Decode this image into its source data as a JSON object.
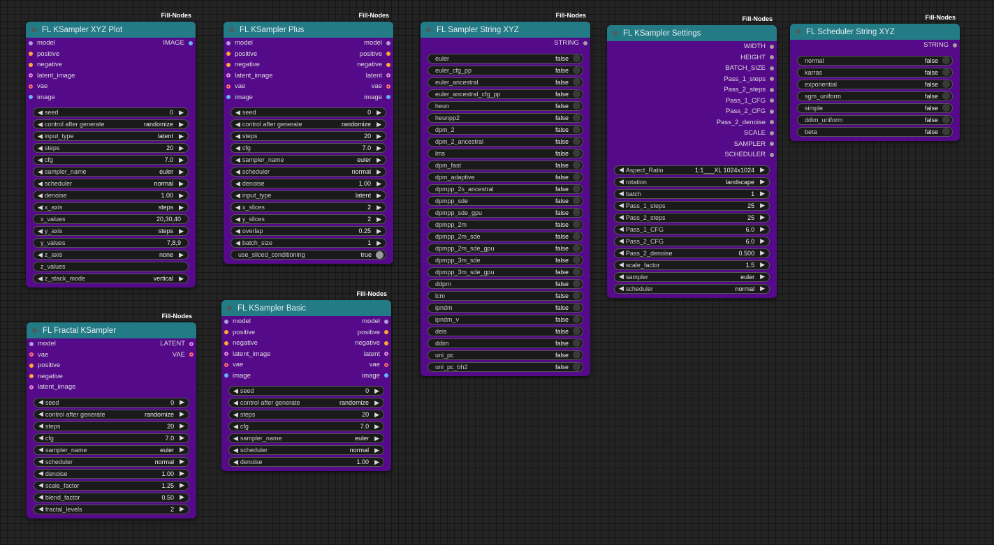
{
  "colors": {
    "header": "#237b86",
    "body": "#550a8a",
    "model_port": "#b39ddb",
    "cond_port": "#ffa931",
    "latent_port": "#ff9cf9",
    "vae_port": "#ff6e6e",
    "image_port": "#64b5f6",
    "string_port": "#a0a0a0"
  },
  "badge": "Fill-Nodes",
  "nodes": {
    "xyz_plot": {
      "title": "FL KSampler XYZ Plot",
      "inputs": [
        "model",
        "positive",
        "negative",
        "latent_image",
        "vae",
        "image"
      ],
      "outputs": [
        "IMAGE"
      ],
      "widgets": [
        {
          "label": "seed",
          "value": "0"
        },
        {
          "label": "control after generate",
          "value": "randomize"
        },
        {
          "label": "input_type",
          "value": "latent"
        },
        {
          "label": "steps",
          "value": "20"
        },
        {
          "label": "cfg",
          "value": "7.0"
        },
        {
          "label": "sampler_name",
          "value": "euler"
        },
        {
          "label": "scheduler",
          "value": "normal"
        },
        {
          "label": "denoise",
          "value": "1.00"
        },
        {
          "label": "x_axis",
          "value": "steps"
        },
        {
          "label": "x_values",
          "value": "20,30,40"
        },
        {
          "label": "y_axis",
          "value": "steps"
        },
        {
          "label": "y_values",
          "value": "7,8,9"
        },
        {
          "label": "z_axis",
          "value": "none"
        },
        {
          "label": "z_values",
          "value": ""
        },
        {
          "label": "z_stack_mode",
          "value": "vertical"
        }
      ]
    },
    "fractal": {
      "title": "FL Fractal KSampler",
      "inputs": [
        "model",
        "vae",
        "positive",
        "negative",
        "latent_image"
      ],
      "outputs": [
        "LATENT",
        "VAE"
      ],
      "widgets": [
        {
          "label": "seed",
          "value": "0"
        },
        {
          "label": "control after generate",
          "value": "randomize"
        },
        {
          "label": "steps",
          "value": "20"
        },
        {
          "label": "cfg",
          "value": "7.0"
        },
        {
          "label": "sampler_name",
          "value": "euler"
        },
        {
          "label": "scheduler",
          "value": "normal"
        },
        {
          "label": "denoise",
          "value": "1.00"
        },
        {
          "label": "scale_factor",
          "value": "1.25"
        },
        {
          "label": "blend_factor",
          "value": "0.50"
        },
        {
          "label": "fractal_levels",
          "value": "2"
        }
      ]
    },
    "plus": {
      "title": "FL KSampler Plus",
      "inputs": [
        "model",
        "positive",
        "negative",
        "latent_image",
        "vae",
        "image"
      ],
      "outputs": [
        "model",
        "positive",
        "negative",
        "latent",
        "vae",
        "image"
      ],
      "widgets": [
        {
          "label": "seed",
          "value": "0"
        },
        {
          "label": "control after generate",
          "value": "randomize"
        },
        {
          "label": "steps",
          "value": "20"
        },
        {
          "label": "cfg",
          "value": "7.0"
        },
        {
          "label": "sampler_name",
          "value": "euler"
        },
        {
          "label": "scheduler",
          "value": "normal"
        },
        {
          "label": "denoise",
          "value": "1.00"
        },
        {
          "label": "input_type",
          "value": "latent"
        },
        {
          "label": "x_slices",
          "value": "2"
        },
        {
          "label": "y_slices",
          "value": "2"
        },
        {
          "label": "overlap",
          "value": "0.25"
        },
        {
          "label": "batch_size",
          "value": "1"
        }
      ],
      "toggle": {
        "label": "use_sliced_conditioning",
        "value": "true"
      }
    },
    "basic": {
      "title": "FL KSampler Basic",
      "inputs": [
        "model",
        "positive",
        "negative",
        "latent_image",
        "vae",
        "image"
      ],
      "outputs": [
        "model",
        "positive",
        "negative",
        "latent",
        "vae",
        "image"
      ],
      "widgets": [
        {
          "label": "seed",
          "value": "0"
        },
        {
          "label": "control after generate",
          "value": "randomize"
        },
        {
          "label": "steps",
          "value": "20"
        },
        {
          "label": "cfg",
          "value": "7.0"
        },
        {
          "label": "sampler_name",
          "value": "euler"
        },
        {
          "label": "scheduler",
          "value": "normal"
        },
        {
          "label": "denoise",
          "value": "1.00"
        }
      ]
    },
    "sampler_string": {
      "title": "FL Sampler String XYZ",
      "outputs": [
        "STRING"
      ],
      "toggles": [
        {
          "label": "euler",
          "value": "false"
        },
        {
          "label": "euler_cfg_pp",
          "value": "false"
        },
        {
          "label": "euler_ancestral",
          "value": "false"
        },
        {
          "label": "euler_ancestral_cfg_pp",
          "value": "false"
        },
        {
          "label": "heun",
          "value": "false"
        },
        {
          "label": "heunpp2",
          "value": "false"
        },
        {
          "label": "dpm_2",
          "value": "false"
        },
        {
          "label": "dpm_2_ancestral",
          "value": "false"
        },
        {
          "label": "lms",
          "value": "false"
        },
        {
          "label": "dpm_fast",
          "value": "false"
        },
        {
          "label": "dpm_adaptive",
          "value": "false"
        },
        {
          "label": "dpmpp_2s_ancestral",
          "value": "false"
        },
        {
          "label": "dpmpp_sde",
          "value": "false"
        },
        {
          "label": "dpmpp_sde_gpu",
          "value": "false"
        },
        {
          "label": "dpmpp_2m",
          "value": "false"
        },
        {
          "label": "dpmpp_2m_sde",
          "value": "false"
        },
        {
          "label": "dpmpp_2m_sde_gpu",
          "value": "false"
        },
        {
          "label": "dpmpp_3m_sde",
          "value": "false"
        },
        {
          "label": "dpmpp_3m_sde_gpu",
          "value": "false"
        },
        {
          "label": "ddpm",
          "value": "false"
        },
        {
          "label": "lcm",
          "value": "false"
        },
        {
          "label": "ipndm",
          "value": "false"
        },
        {
          "label": "ipndm_v",
          "value": "false"
        },
        {
          "label": "deis",
          "value": "false"
        },
        {
          "label": "ddim",
          "value": "false"
        },
        {
          "label": "uni_pc",
          "value": "false"
        },
        {
          "label": "uni_pc_bh2",
          "value": "false"
        }
      ]
    },
    "settings": {
      "title": "FL KSampler Settings",
      "outputs": [
        "WIDTH",
        "HEIGHT",
        "BATCH_SIZE",
        "Pass_1_steps",
        "Pass_2_steps",
        "Pass_1_CFG",
        "Pass_2_CFG",
        "Pass_2_denoise",
        "SCALE",
        "SAMPLER",
        "SCHEDULER"
      ],
      "widgets": [
        {
          "label": "Aspect_Ratio",
          "value": "1:1___XL 1024x1024"
        },
        {
          "label": "rotation",
          "value": "landscape"
        },
        {
          "label": "batch",
          "value": "1"
        },
        {
          "label": "Pass_1_steps",
          "value": "25"
        },
        {
          "label": "Pass_2_steps",
          "value": "25"
        },
        {
          "label": "Pass_1_CFG",
          "value": "6.0"
        },
        {
          "label": "Pass_2_CFG",
          "value": "6.0"
        },
        {
          "label": "Pass_2_denoise",
          "value": "0.500"
        },
        {
          "label": "scale_factor",
          "value": "1.5"
        },
        {
          "label": "sampler",
          "value": "euler"
        },
        {
          "label": "scheduler",
          "value": "normal"
        }
      ]
    },
    "scheduler_string": {
      "title": "FL Scheduler String XYZ",
      "outputs": [
        "STRING"
      ],
      "toggles": [
        {
          "label": "normal",
          "value": "false"
        },
        {
          "label": "karras",
          "value": "false"
        },
        {
          "label": "exponential",
          "value": "false"
        },
        {
          "label": "sgm_uniform",
          "value": "false"
        },
        {
          "label": "simple",
          "value": "false"
        },
        {
          "label": "ddim_uniform",
          "value": "false"
        },
        {
          "label": "beta",
          "value": "false"
        }
      ]
    }
  }
}
